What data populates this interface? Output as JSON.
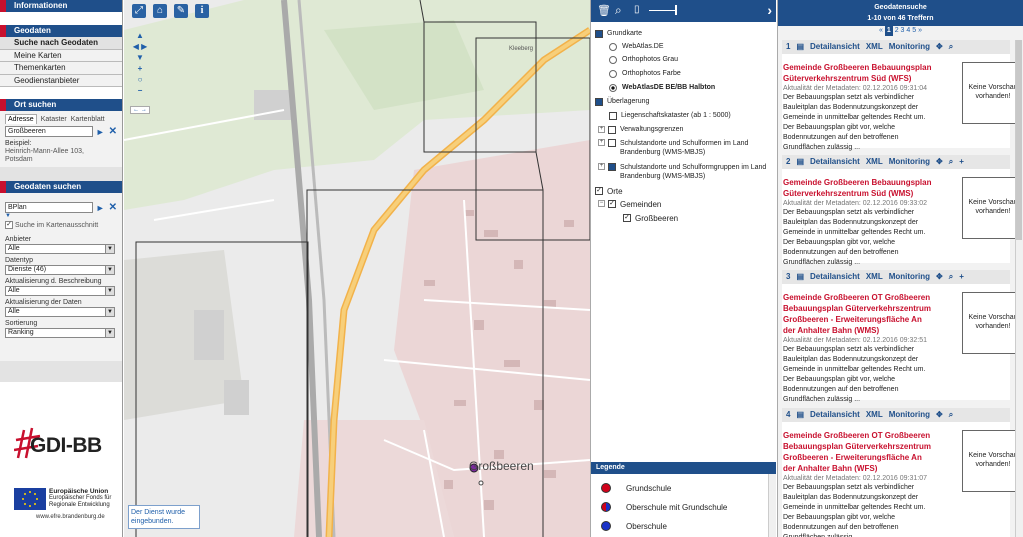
{
  "left": {
    "info_header": "Informationen",
    "geodaten_header": "Geodaten",
    "nav": [
      "Suche nach Geodaten",
      "Meine Karten",
      "Themenkarten",
      "Geodienstanbieter"
    ],
    "ort_header": "Ort suchen",
    "ort_tabs": [
      "Adresse",
      "Kataster",
      "Kartenblatt"
    ],
    "ort_value": "Großbeeren",
    "beispiel_label": "Beispiel:",
    "beispiel_text": "Heinrich-Mann-Allee 103, Potsdam",
    "geo_header": "Geodaten suchen",
    "geo_value": "BPlan",
    "kartenausschnitt": "Suche im Kartenausschnitt",
    "filters": [
      {
        "label": "Anbieter",
        "value": "Alle"
      },
      {
        "label": "Datentyp",
        "value": "Dienste (46)"
      },
      {
        "label": "Aktualisierung d. Beschreibung",
        "value": "Alle"
      },
      {
        "label": "Aktualisierung der Daten",
        "value": "Alle"
      },
      {
        "label": "Sortierung",
        "value": "Ranking"
      }
    ],
    "logo": "GDI-BB",
    "eu_line1": "Europäische Union",
    "eu_line2": "Europäischer Fonds für Regionale Entwicklung",
    "eu_url": "www.efre.brandenburg.de"
  },
  "map": {
    "place_large": "Großbeeren",
    "place_small": "Kleeberg",
    "road_label": "Großbeeren",
    "notice": "Der Dienst wurde eingebunden."
  },
  "tree": {
    "grundkarte": "Grundkarte",
    "base": [
      {
        "label": "WebAtlas.DE",
        "on": false
      },
      {
        "label": "Orthophotos Grau",
        "on": false
      },
      {
        "label": "Orthophotos Farbe",
        "on": false
      },
      {
        "label": "WebAtlasDE BE/BB Halbton",
        "on": true
      }
    ],
    "ueberlagerung": "Überlagerung",
    "overlays": [
      "Liegenschaftskataster (ab 1 : 5000)",
      "Verwaltungsgrenzen",
      "Schulstandorte und Schulformen im Land Brandenburg (WMS-MBJS)",
      "Schulstandorte und Schulformgruppen im Land Brandenburg (WMS-MBJS)"
    ],
    "orte": "Orte",
    "gemeinden": "Gemeinden",
    "grossbeeren": "Großbeeren"
  },
  "legend": {
    "title": "Legende",
    "items": [
      {
        "label": "Grundschule",
        "color": "#d0021b"
      },
      {
        "label": "Oberschule mit Grundschule",
        "color": "#7a2a9c"
      },
      {
        "label": "Oberschule",
        "color": "#1a33c8"
      }
    ]
  },
  "results": {
    "title": "Geodatensuche",
    "count": "1-10 von 46 Treffern",
    "pages": [
      "1",
      "2",
      "3",
      "4",
      "5",
      "»"
    ],
    "prev_arrow": "«",
    "actions": {
      "detail": "Detailansicht",
      "xml": "XML",
      "monitoring": "Monitoring"
    },
    "preview": "Keine Vorschau vorhanden!",
    "desc": "Der Bebauungsplan setzt als verbindlicher Bauleitplan das Bodennutzungskonzept der Gemeinde in unmittelbar geltendes Recht um. Der Bebauungsplan gibt vor, welche Bodennutzungen auf den betroffenen Grundflächen zulässig ...",
    "items": [
      {
        "num": "1",
        "title": "Gemeinde Großbeeren Bebauungsplan Güterverkehrszentrum Süd (WFS)",
        "meta": "Aktualität der Metadaten: 02.12.2016 09:31:04"
      },
      {
        "num": "2",
        "title": "Gemeinde Großbeeren Bebauungsplan Güterverkehrszentrum Süd (WMS)",
        "meta": "Aktualität der Metadaten: 02.12.2016 09:33:02"
      },
      {
        "num": "3",
        "title": "Gemeinde Großbeeren OT Großbeeren Bebauungsplan Güterverkehrszentrum Großbeeren - Erweiterungsfläche An der Anhalter Bahn (WMS)",
        "meta": "Aktualität der Metadaten: 02.12.2016 09:32:51"
      },
      {
        "num": "4",
        "title": "Gemeinde Großbeeren OT Großbeeren Bebauungsplan Güterverkehrszentrum Großbeeren - Erweiterungsfläche An der Anhalter Bahn (WFS)",
        "meta": "Aktualität der Metadaten: 02.12.2016 09:31:07"
      }
    ]
  }
}
